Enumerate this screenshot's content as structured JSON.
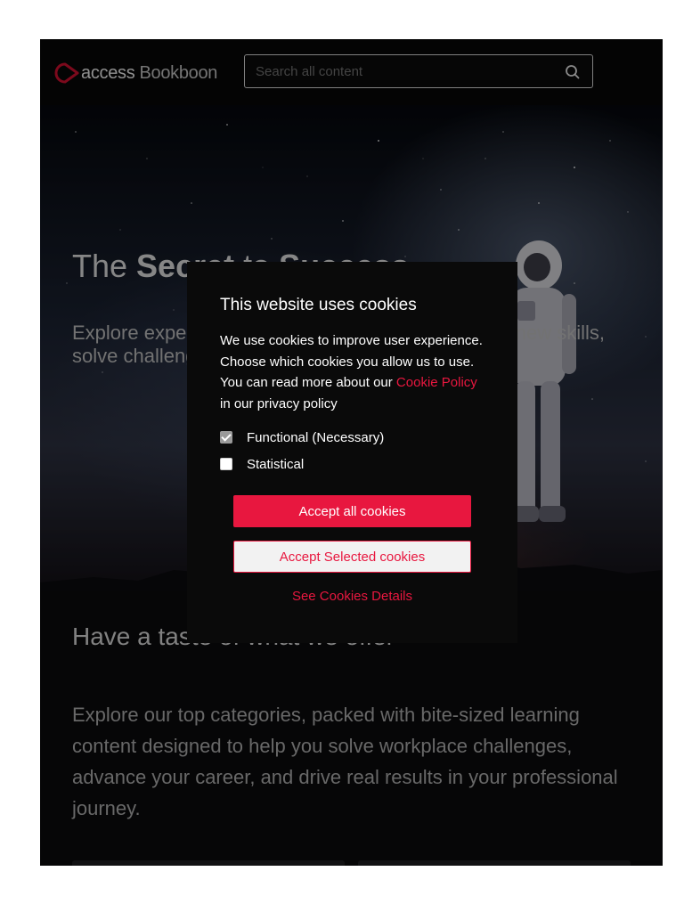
{
  "header": {
    "logo_word": "access",
    "logo_word2": "Bookboon",
    "search_placeholder": "Search all content"
  },
  "hero": {
    "title_part1": "The ",
    "title_bold1": "Secret",
    "title_part2": " to ",
    "title_bold2": "Success",
    "subtitle": "Explore expert-led content from Bookboon to learn new skills, solve challenges and drive real success"
  },
  "section": {
    "title": "Have a taste of what we offer",
    "text": "Explore our top categories, packed with bite-sized learning content designed to help you solve workplace challenges, advance your career, and drive real results in your professional journey."
  },
  "cookie_modal": {
    "title": "This website uses cookies",
    "text_before_link": "We use cookies to improve user experience. Choose which cookies you allow us to use. You can read more about our ",
    "link_text": "Cookie Policy",
    "text_after_link": " in our privacy policy",
    "options": [
      {
        "label": "Functional (Necessary)",
        "checked": true
      },
      {
        "label": "Statistical",
        "checked": false
      }
    ],
    "accept_all_label": "Accept all cookies",
    "accept_selected_label": "Accept Selected cookies",
    "details_label": "See Cookies Details"
  },
  "colors": {
    "accent": "#e8173f",
    "background": "#0a0a0c",
    "modal_background": "#0a0a0a"
  }
}
